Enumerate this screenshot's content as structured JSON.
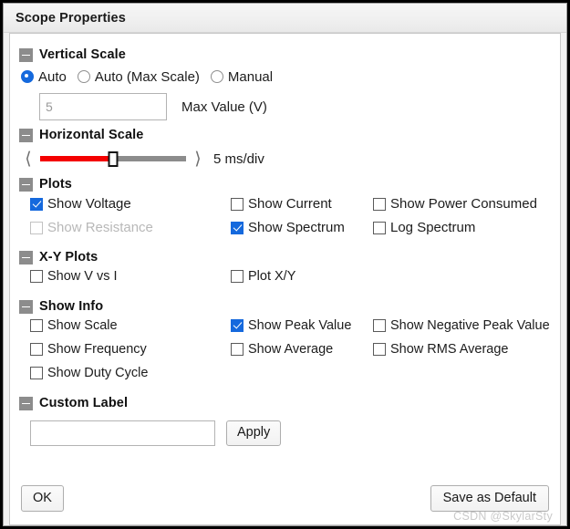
{
  "window": {
    "title": "Scope Properties"
  },
  "vertical_scale": {
    "section_title": "Vertical Scale",
    "collapse_icon": "minus-icon",
    "options": [
      {
        "label": "Auto",
        "selected": true
      },
      {
        "label": "Auto (Max Scale)",
        "selected": false
      },
      {
        "label": "Manual",
        "selected": false
      }
    ],
    "max_value": {
      "value": "",
      "placeholder": "5",
      "label": "Max Value (V)"
    }
  },
  "horizontal_scale": {
    "section_title": "Horizontal Scale",
    "collapse_icon": "minus-icon",
    "left_arrow_icon": "chevron-left-icon",
    "right_arrow_icon": "chevron-right-icon",
    "slider": {
      "percent": 50,
      "fill_color": "#f40000",
      "track_color": "#8c8c8c"
    },
    "value_label": "5 ms/div"
  },
  "plots": {
    "section_title": "Plots",
    "collapse_icon": "minus-icon",
    "items": [
      {
        "label": "Show Voltage",
        "checked": true,
        "disabled": false,
        "col": 1,
        "row": 1
      },
      {
        "label": "Show Current",
        "checked": false,
        "disabled": false,
        "col": 2,
        "row": 1
      },
      {
        "label": "Show Power Consumed",
        "checked": false,
        "disabled": false,
        "col": 3,
        "row": 1
      },
      {
        "label": "Show Resistance",
        "checked": false,
        "disabled": true,
        "col": 1,
        "row": 2
      },
      {
        "label": "Show Spectrum",
        "checked": true,
        "disabled": false,
        "col": 2,
        "row": 2
      },
      {
        "label": "Log Spectrum",
        "checked": false,
        "disabled": false,
        "col": 3,
        "row": 2
      }
    ]
  },
  "xy_plots": {
    "section_title": "X-Y Plots",
    "collapse_icon": "minus-icon",
    "items": [
      {
        "label": "Show V vs I",
        "checked": false,
        "disabled": false,
        "col": 1,
        "row": 1
      },
      {
        "label": "Plot X/Y",
        "checked": false,
        "disabled": false,
        "col": 2,
        "row": 1
      }
    ]
  },
  "show_info": {
    "section_title": "Show Info",
    "collapse_icon": "minus-icon",
    "items": [
      {
        "label": "Show Scale",
        "checked": false,
        "disabled": false,
        "col": 1,
        "row": 1
      },
      {
        "label": "Show Peak Value",
        "checked": true,
        "disabled": false,
        "col": 2,
        "row": 1
      },
      {
        "label": "Show Negative Peak Value",
        "checked": false,
        "disabled": false,
        "col": 3,
        "row": 1
      },
      {
        "label": "Show Frequency",
        "checked": false,
        "disabled": false,
        "col": 1,
        "row": 2
      },
      {
        "label": "Show Average",
        "checked": false,
        "disabled": false,
        "col": 2,
        "row": 2
      },
      {
        "label": "Show RMS Average",
        "checked": false,
        "disabled": false,
        "col": 3,
        "row": 2
      },
      {
        "label": "Show Duty Cycle",
        "checked": false,
        "disabled": false,
        "col": 1,
        "row": 3
      }
    ]
  },
  "custom_label": {
    "section_title": "Custom Label",
    "collapse_icon": "minus-icon",
    "input_value": "",
    "input_placeholder": "",
    "apply_label": "Apply"
  },
  "footer": {
    "ok_label": "OK",
    "save_default_label": "Save as Default"
  },
  "watermark": {
    "text": "CSDN @SkylarSty"
  },
  "colors": {
    "accent": "#1569dd",
    "slider_fill": "#f40000",
    "section_btn": "#8c8c8c",
    "disabled_text": "#b8b8b8"
  }
}
